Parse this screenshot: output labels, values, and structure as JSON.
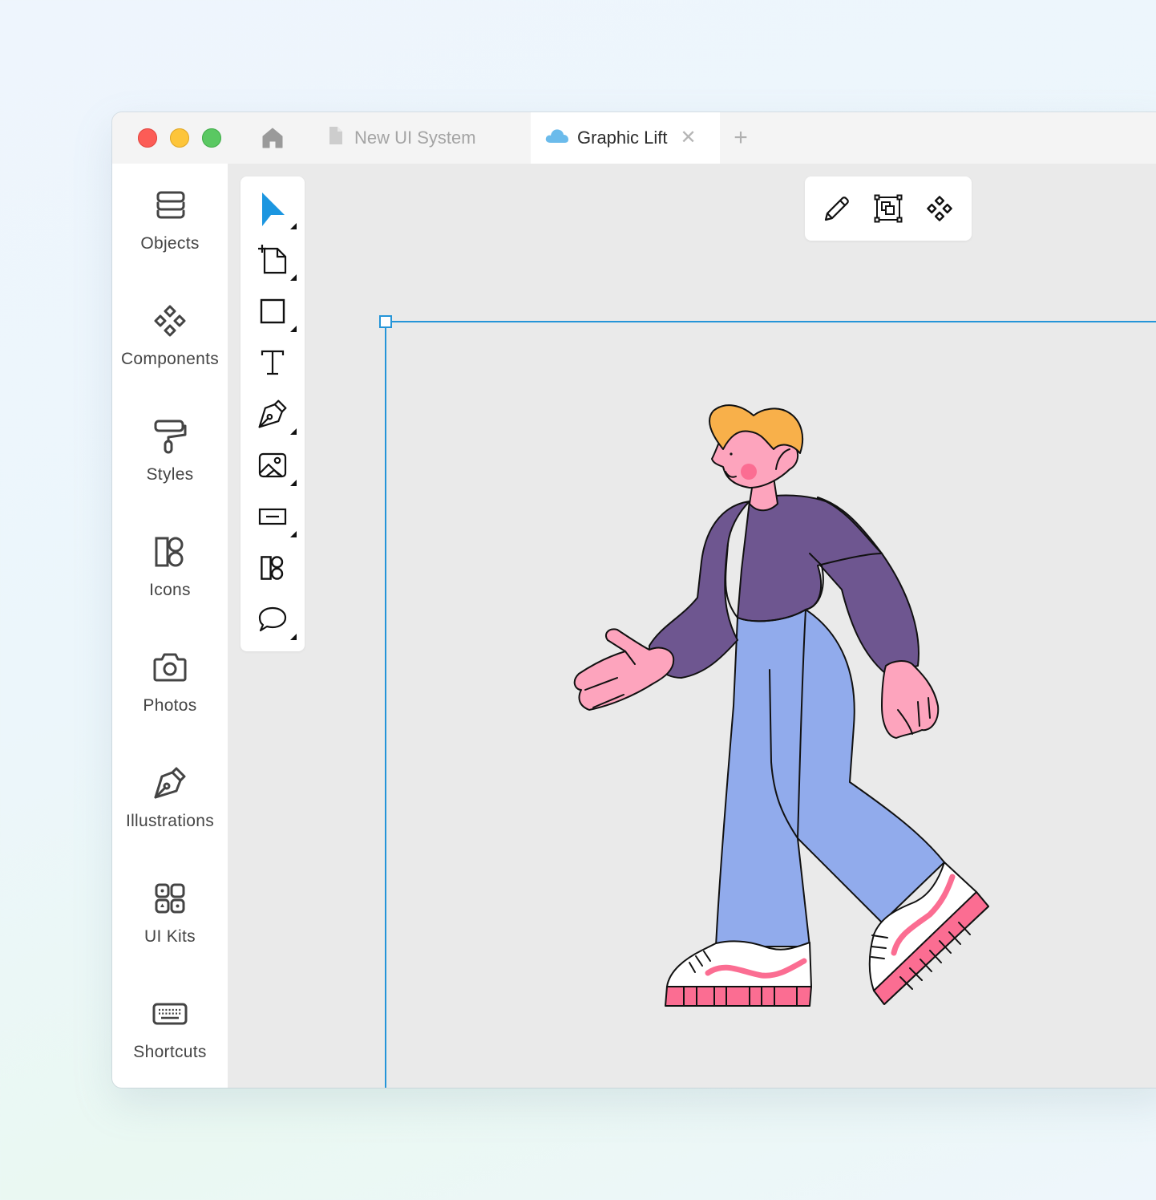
{
  "window": {
    "traffic_lights": [
      "close",
      "minimize",
      "zoom"
    ],
    "tabs": [
      {
        "label": "New UI System",
        "icon": "document-icon",
        "active": false
      },
      {
        "label": "Graphic Lift",
        "icon": "cloud-icon",
        "active": true,
        "close_label": "✕"
      }
    ],
    "new_tab_label": "+",
    "home_icon": "home-icon"
  },
  "sidebar": {
    "items": [
      {
        "label": "Objects",
        "icon": "layers-icon"
      },
      {
        "label": "Components",
        "icon": "components-icon"
      },
      {
        "label": "Styles",
        "icon": "paint-roller-icon"
      },
      {
        "label": "Icons",
        "icon": "icons-icon"
      },
      {
        "label": "Photos",
        "icon": "camera-icon"
      },
      {
        "label": "Illustrations",
        "icon": "pen-nib-icon"
      },
      {
        "label": "UI Kits",
        "icon": "ui-kits-icon"
      },
      {
        "label": "Shortcuts",
        "icon": "keyboard-icon"
      }
    ]
  },
  "toolbar": {
    "tools": [
      {
        "name": "select",
        "icon": "cursor-arrow-icon",
        "active": true,
        "has_submenu": true
      },
      {
        "name": "artboard",
        "icon": "artboard-icon",
        "has_submenu": true
      },
      {
        "name": "rectangle",
        "icon": "rectangle-icon",
        "has_submenu": true
      },
      {
        "name": "text",
        "icon": "text-icon",
        "has_submenu": false
      },
      {
        "name": "pen",
        "icon": "pen-tool-icon",
        "has_submenu": true
      },
      {
        "name": "image",
        "icon": "image-icon",
        "has_submenu": true
      },
      {
        "name": "input",
        "icon": "input-field-icon",
        "has_submenu": true
      },
      {
        "name": "icons",
        "icon": "icons-icon",
        "has_submenu": false
      },
      {
        "name": "comment",
        "icon": "comment-icon",
        "has_submenu": true
      }
    ],
    "active_color": "#1c96e0"
  },
  "context_bar": {
    "actions": [
      {
        "name": "edit",
        "icon": "pencil-icon"
      },
      {
        "name": "group-selection",
        "icon": "selection-group-icon"
      },
      {
        "name": "create-component",
        "icon": "components-icon"
      }
    ]
  },
  "canvas": {
    "selection_color": "#2595d8",
    "illustration": "walking-person-illustration",
    "palette": {
      "hair": "#f8b04a",
      "skin": "#fda4bd",
      "cheek": "#fb6d92",
      "sweater": "#6e5690",
      "pants": "#91abec",
      "shoe": "#ffffff",
      "sole": "#fb6d92",
      "outline": "#111111"
    }
  }
}
